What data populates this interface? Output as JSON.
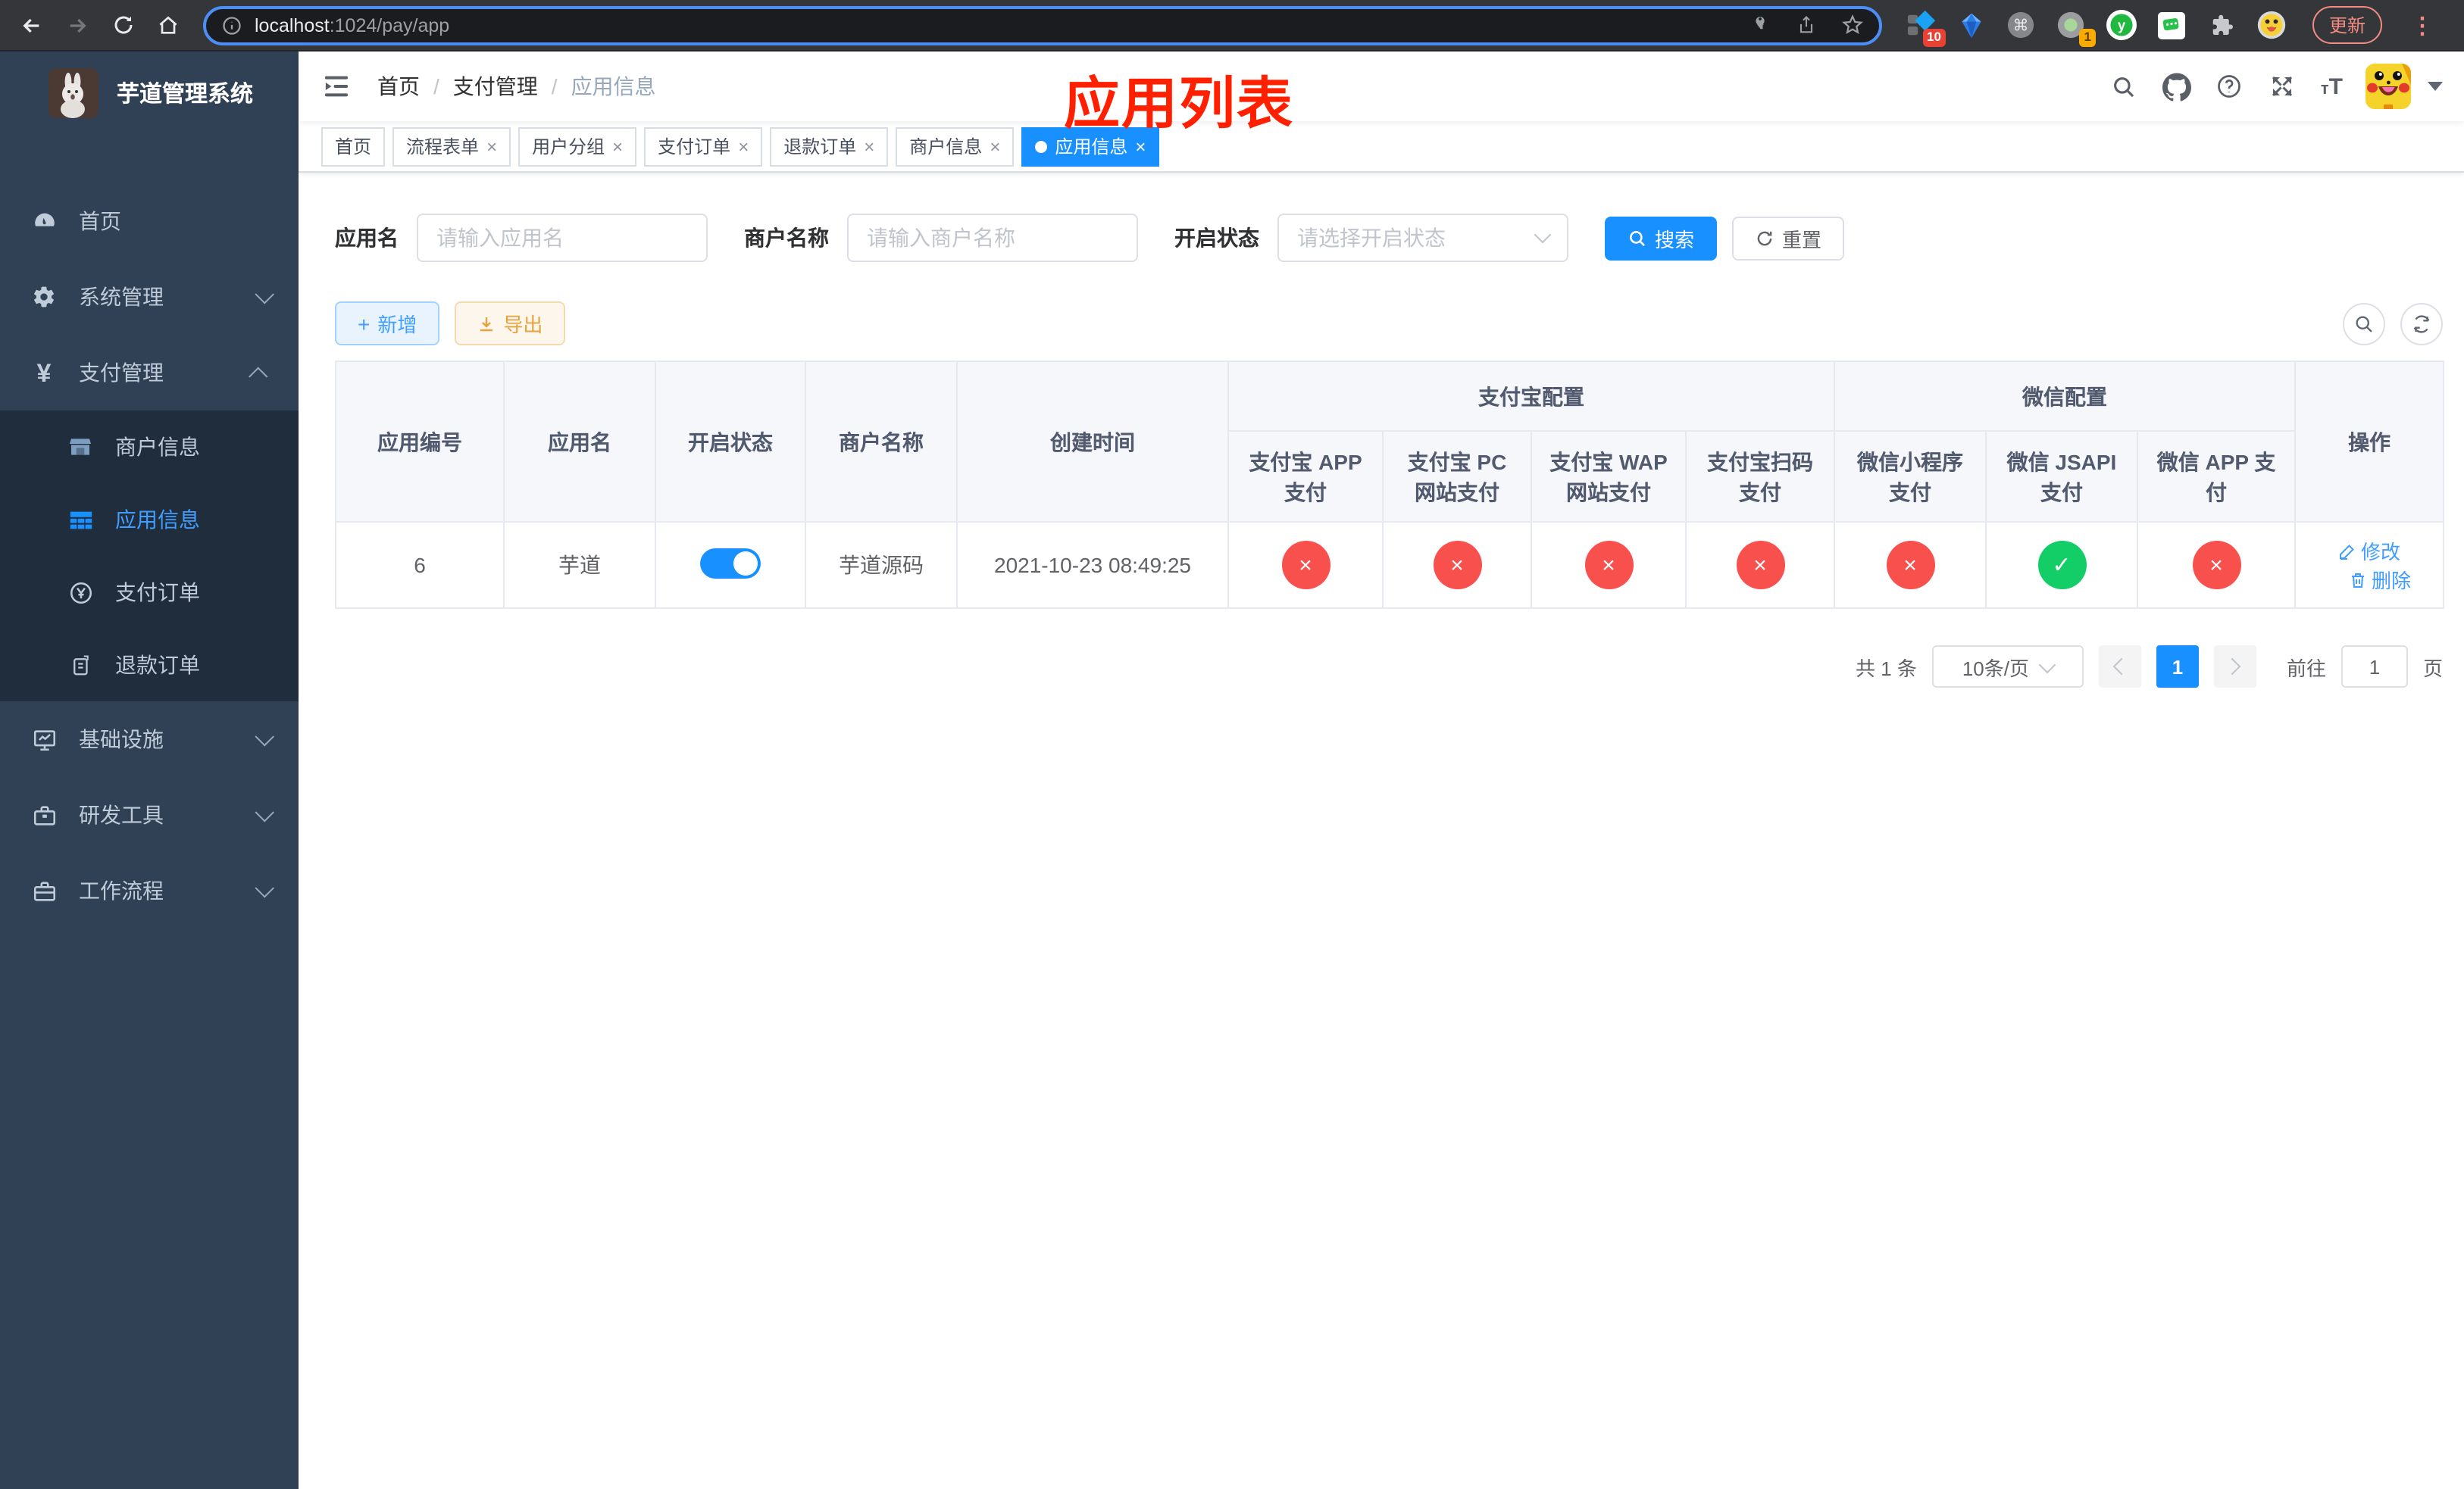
{
  "browser": {
    "url_host": "localhost",
    "url_path": ":1024/pay/app",
    "ext_badge_red": "10",
    "ext_badge_orange": "1",
    "update_label": "更新"
  },
  "sidebar": {
    "title": "芋道管理系统",
    "items": [
      {
        "label": "首页",
        "icon": "dashboard-icon",
        "level": "top",
        "active": false,
        "chevron": null
      },
      {
        "label": "系统管理",
        "icon": "gear-icon",
        "level": "top",
        "active": false,
        "chevron": "down"
      },
      {
        "label": "支付管理",
        "icon": "yen-icon",
        "level": "top",
        "active": false,
        "chevron": "up"
      },
      {
        "label": "商户信息",
        "icon": "shop-icon",
        "level": "sub",
        "active": false,
        "chevron": null
      },
      {
        "label": "应用信息",
        "icon": "grid-icon",
        "level": "sub",
        "active": true,
        "chevron": null
      },
      {
        "label": "支付订单",
        "icon": "yen-circle-icon",
        "level": "sub",
        "active": false,
        "chevron": null
      },
      {
        "label": "退款订单",
        "icon": "document-icon",
        "level": "sub",
        "active": false,
        "chevron": null
      },
      {
        "label": "基础设施",
        "icon": "monitor-icon",
        "level": "top",
        "active": false,
        "chevron": "down"
      },
      {
        "label": "研发工具",
        "icon": "toolbox-icon",
        "level": "top",
        "active": false,
        "chevron": "down"
      },
      {
        "label": "工作流程",
        "icon": "briefcase-icon",
        "level": "top",
        "active": false,
        "chevron": "down"
      }
    ]
  },
  "header": {
    "breadcrumb": [
      "首页",
      "支付管理",
      "应用信息"
    ],
    "annotation": "应用列表"
  },
  "tags": [
    {
      "label": "首页",
      "closable": false,
      "active": false
    },
    {
      "label": "流程表单",
      "closable": true,
      "active": false
    },
    {
      "label": "用户分组",
      "closable": true,
      "active": false
    },
    {
      "label": "支付订单",
      "closable": true,
      "active": false
    },
    {
      "label": "退款订单",
      "closable": true,
      "active": false
    },
    {
      "label": "商户信息",
      "closable": true,
      "active": false
    },
    {
      "label": "应用信息",
      "closable": true,
      "active": true
    }
  ],
  "filters": {
    "app_name_label": "应用名",
    "app_name_placeholder": "请输入应用名",
    "merchant_label": "商户名称",
    "merchant_placeholder": "请输入商户名称",
    "status_label": "开启状态",
    "status_placeholder": "请选择开启状态",
    "search_label": "搜索",
    "reset_label": "重置"
  },
  "toolbar": {
    "add_label": "新增",
    "export_label": "导出"
  },
  "table": {
    "groups": {
      "alipay": "支付宝配置",
      "wechat": "微信配置"
    },
    "columns": {
      "id": "应用编号",
      "name": "应用名",
      "status": "开启状态",
      "merchant": "商户名称",
      "created": "创建时间",
      "alipay_app": "支付宝 APP 支付",
      "alipay_pc": "支付宝 PC 网站支付",
      "alipay_wap": "支付宝 WAP 网站支付",
      "alipay_qr": "支付宝扫码支付",
      "wx_lite": "微信小程序支付",
      "wx_jsapi": "微信 JSAPI 支付",
      "wx_app": "微信 APP 支付",
      "actions": "操作"
    },
    "row": {
      "id": "6",
      "name": "芋道",
      "enabled": true,
      "merchant": "芋道源码",
      "created": "2021-10-23 08:49:25",
      "channels": [
        false,
        false,
        false,
        false,
        false,
        true,
        false
      ]
    },
    "ok_glyph": "✓",
    "fail_glyph": "×",
    "edit_label": "修改",
    "delete_label": "删除"
  },
  "pagination": {
    "total": "共 1 条",
    "page_size": "10条/页",
    "current": "1",
    "goto_label": "前往",
    "goto_value": "1",
    "page_unit": "页"
  },
  "colors": {
    "primary": "#409eff",
    "primary_solid": "#1890ff",
    "success": "#13ce66",
    "danger": "#f8514d",
    "warning": "#e6a23c",
    "sidebar_bg": "#304156",
    "submenu_bg": "#1f2d3d",
    "annotation_red": "#ff2000"
  }
}
